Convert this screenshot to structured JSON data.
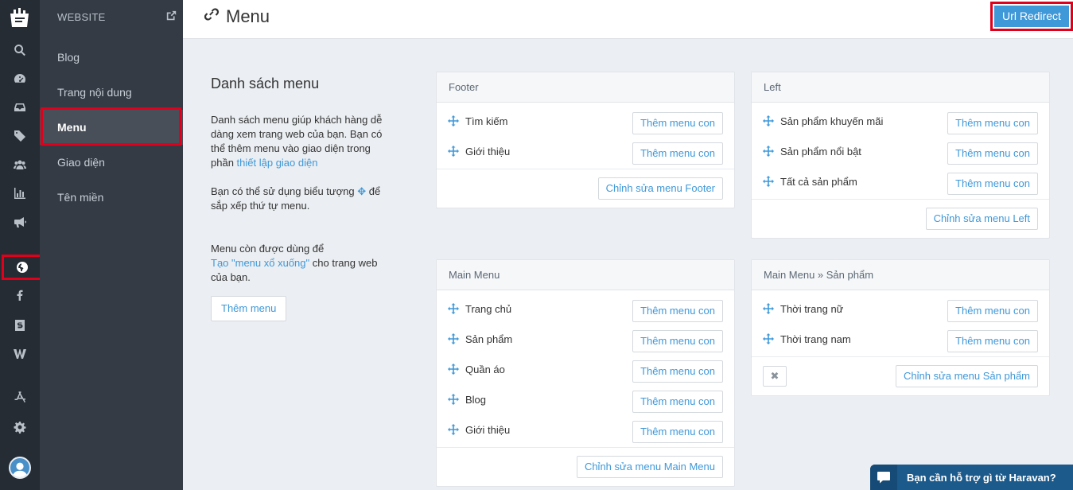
{
  "rail": {
    "icons": [
      "logo-icon",
      "search-icon",
      "dashboard-icon",
      "inbox-icon",
      "tag-icon",
      "users-icon",
      "chart-icon",
      "megaphone-icon",
      "globe-icon",
      "facebook-icon",
      "s-icon",
      "w-icon",
      "app-store-icon",
      "gear-icon",
      "avatar"
    ]
  },
  "subnav": {
    "header": "WEBSITE",
    "items": [
      "Blog",
      "Trang nội dung",
      "Menu",
      "Giao diện",
      "Tên miền"
    ]
  },
  "topbar": {
    "title": "Menu",
    "redirect_label": "Url Redirect"
  },
  "intro": {
    "heading": "Danh sách menu",
    "p1": "Danh sách menu giúp khách hàng dễ dàng xem trang web của bạn. Bạn có thể thêm menu vào giao diện trong phần",
    "p1_link": "thiết lập giao diện",
    "p2_before": "Bạn có thể sử dụng biểu tượng",
    "p2_after": "để sắp xếp thứ tự menu.",
    "p3_before": "Menu còn được dùng để",
    "p3_link": "Tạo \"menu xổ xuống\"",
    "p3_after": "cho trang web của bạn.",
    "add_button": "Thêm menu"
  },
  "sub_label": "Thêm menu con",
  "cards": {
    "footer": {
      "title": "Footer",
      "items": [
        "Tìm kiếm",
        "Giới thiệu"
      ],
      "edit": "Chỉnh sửa menu Footer"
    },
    "left": {
      "title": "Left",
      "items": [
        "Sản phẩm khuyến mãi",
        "Sản phẩm nổi bật",
        "Tất cả sản phẩm"
      ],
      "edit": "Chỉnh sửa menu Left"
    },
    "main": {
      "title": "Main Menu",
      "items": [
        "Trang chủ",
        "Sản phẩm",
        "Quần áo",
        "Blog",
        "Giới thiệu"
      ],
      "edit": "Chỉnh sửa menu Main Menu"
    },
    "products": {
      "title": "Main Menu » Sản phẩm",
      "items": [
        "Thời trang nữ",
        "Thời trang nam"
      ],
      "edit": "Chỉnh sửa menu Sản phẩm",
      "delete": "✖"
    }
  },
  "help": {
    "label": "Bạn cần hỗ trợ gì từ Haravan?"
  },
  "colors": {
    "accent": "#3f98d8",
    "rail": "#262c34",
    "subnav": "#343b45",
    "highlight": "#e0001b"
  }
}
